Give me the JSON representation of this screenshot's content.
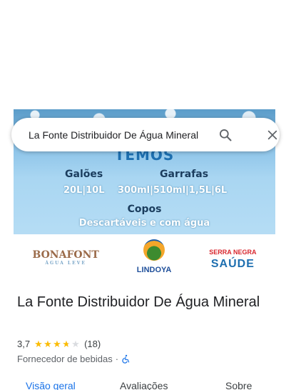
{
  "search": {
    "query": "La Fonte Distribuidor De Água Mineral"
  },
  "photo": {
    "heading": "TEMOS",
    "col1_label": "Galões",
    "col2_label": "Garrafas",
    "col1_sizes": "20L|10L",
    "col2_sizes": "300ml|510ml|1,5L|6L",
    "copos": "Copos",
    "descartaveis": "Descartáveis e com água",
    "logos": {
      "bonafont": "BONAFONT",
      "bonafont_sub": "ÁGUA LEVE",
      "lindoya": "LINDOYA",
      "serra_top": "SERRA NEGRA",
      "serra_name": "SAÚDE"
    }
  },
  "place": {
    "name": "La Fonte Distribuidor De Água Mineral",
    "rating": "3,7",
    "rating_value": 3.7,
    "review_count": "(18)",
    "category": "Fornecedor de bebidas",
    "separator": "·"
  },
  "tabs": {
    "overview": "Visão geral",
    "reviews": "Avaliações",
    "about": "Sobre"
  },
  "colors": {
    "accent": "#1a73e8",
    "star": "#fbbc04",
    "star_empty": "#dadce0"
  },
  "icons": {
    "search": "search-icon",
    "close": "close-icon",
    "accessibility": "wheelchair-icon"
  }
}
